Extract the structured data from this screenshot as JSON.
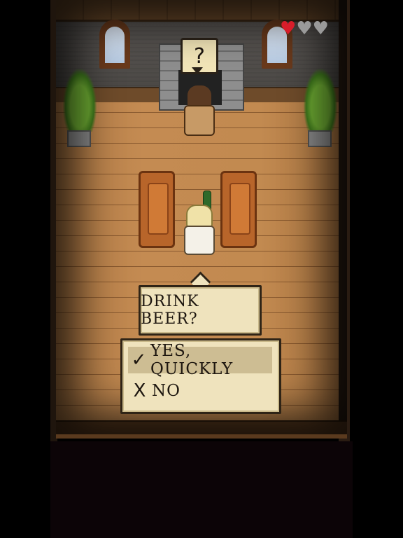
{
  "hud": {
    "hearts": {
      "full": 1,
      "total": 3,
      "full_glyph": "♥",
      "empty_glyph": "♥",
      "full_color": "#d81d2a",
      "empty_color": "#9a9a9a"
    }
  },
  "npc": {
    "speech_bubble": "?"
  },
  "dialog": {
    "prompt": "DRINK BEER?",
    "choices": [
      {
        "mark": "✓",
        "label": "YES, QUICKLY",
        "selected": true
      },
      {
        "mark": "X",
        "label": "NO",
        "selected": false
      }
    ]
  },
  "colors": {
    "panel_bg": "#efe3bd",
    "panel_border": "#2f2416",
    "selection_bg": "#cdbd93",
    "floor": "#c48b52"
  }
}
